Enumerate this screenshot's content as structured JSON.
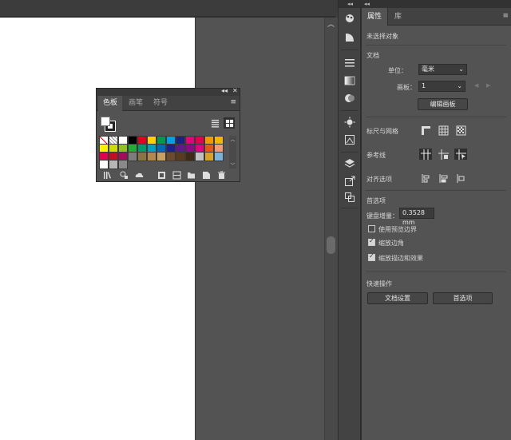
{
  "properties": {
    "tabs": [
      "属性",
      "库"
    ],
    "selection": "未选择对象",
    "document_section": "文档",
    "unit_label": "单位：",
    "unit_value": "毫米",
    "artboard_label": "画板：",
    "artboard_value": "1",
    "edit_artboards": "编辑画板",
    "rulers_grids": "标尺与网格",
    "guides": "参考线",
    "align_options": "对齐选项",
    "preferences_section": "首选项",
    "keyboard_increment_label": "键盘增量：",
    "keyboard_increment_value": "0.3528 mm",
    "use_preview_bounds": "使用预览边界",
    "scale_corners": "缩放边角",
    "scale_strokes_effects": "缩放描边和效果",
    "quick_actions": "快速操作",
    "document_setup": "文档设置",
    "preferences_button": "首选项"
  },
  "checkboxes": {
    "use_preview_bounds": false,
    "scale_corners": true,
    "scale_strokes_effects": true
  },
  "swatches_panel": {
    "tabs": [
      "色板",
      "画笔",
      "符号"
    ],
    "colors": [
      [
        "#ffffff",
        "#ffffff",
        "#ffffff",
        "#000000",
        "#e6001f",
        "#fcd200",
        "#009944",
        "#00a0e9",
        "#1d2088",
        "#e4007f",
        "#e5004f",
        "#f39800",
        "#f8b500"
      ],
      [
        "#fff100",
        "#cfdb00",
        "#8fc31f",
        "#22ac38",
        "#009b6b",
        "#00a0c1",
        "#0068b7",
        "#1d2088",
        "#601986",
        "#920783",
        "#e4007f",
        "#ea5514",
        "#f29b76"
      ],
      [
        "#e5004f",
        "#c30d23",
        "#a40b5d",
        "#7d7d7d",
        "#8a7344",
        "#b28850",
        "#c9a063",
        "#6d4a2c",
        "#5b3a1d",
        "#3e2a15",
        "#c0c0c0",
        "#d7a12a",
        "#7ab3d9"
      ],
      [
        "#ffffff",
        "#b6b6b6",
        "#8a8a8a"
      ]
    ]
  },
  "colors": {
    "panel_bg": "#535353",
    "header_bg": "#323232",
    "artboard": "#ffffff"
  }
}
